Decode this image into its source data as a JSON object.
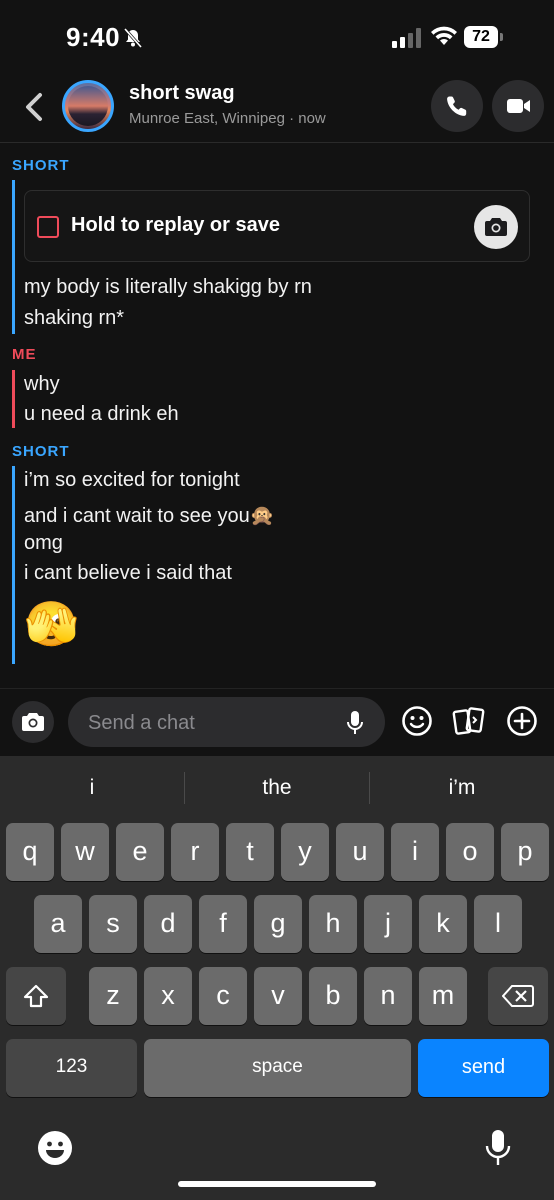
{
  "status_bar": {
    "time": "9:40",
    "battery": "72",
    "icons": [
      "bell-slash-icon",
      "signal-icon",
      "wifi-icon",
      "battery-icon"
    ]
  },
  "header": {
    "name": "short swag",
    "subtitle": "Munroe East, Winnipeg · now",
    "icons": [
      "back-chevron-icon",
      "phone-icon",
      "video-icon"
    ]
  },
  "conversation": {
    "group1": {
      "sender": "SHORT",
      "snap_label": "Hold to replay or save",
      "messages": [
        "my body is literally shakigg by rn",
        "shaking rn*"
      ]
    },
    "group2": {
      "sender": "ME",
      "messages": [
        "why",
        "u need a drink eh"
      ]
    },
    "group3": {
      "sender": "SHORT",
      "messages": [
        "i’m so excited for tonight",
        "and i cant wait to see you🙊",
        "omg",
        "i cant believe i said that",
        "🫣"
      ]
    }
  },
  "chat_input": {
    "placeholder": "Send a chat",
    "icons": [
      "camera-icon",
      "microphone-icon",
      "smiley-icon",
      "cards-icon",
      "plus-icon"
    ]
  },
  "keyboard": {
    "suggestions": [
      "i",
      "the",
      "i’m"
    ],
    "row1": [
      "q",
      "w",
      "e",
      "r",
      "t",
      "y",
      "u",
      "i",
      "o",
      "p"
    ],
    "row2": [
      "a",
      "s",
      "d",
      "f",
      "g",
      "h",
      "j",
      "k",
      "l"
    ],
    "row3": [
      "z",
      "x",
      "c",
      "v",
      "b",
      "n",
      "m"
    ],
    "numbers_key": "123",
    "space_key": "space",
    "send_key": "send",
    "accent_color": "#0a84ff"
  },
  "colors": {
    "short_color": "#3aa6ff",
    "me_color": "#ef4b5a",
    "background": "#121212"
  }
}
